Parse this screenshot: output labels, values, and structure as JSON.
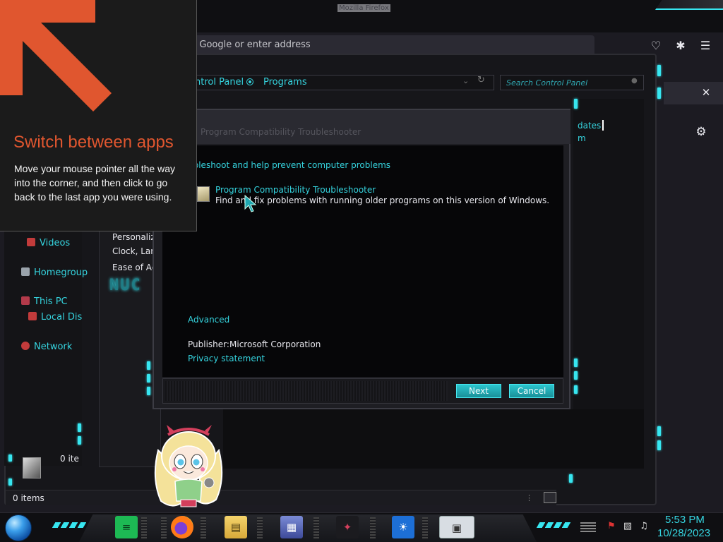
{
  "firefox": {
    "window_title": "Mozilla Firefox",
    "url_placeholder": "n Google or enter address"
  },
  "control_panel": {
    "breadcrumbs": [
      "ntrol Panel",
      "Programs"
    ],
    "search_placeholder": "Search Control Panel",
    "nav": {
      "videos": "Videos",
      "homegroup": "Homegroup",
      "this_pc": "This PC",
      "local_disk": "Local Dis",
      "network": "Network"
    },
    "middle_items": [
      "Personaliz",
      "Clock, Lar",
      "Ease of Ac"
    ],
    "logo_text": "NUC",
    "right_links": [
      "dates",
      "m"
    ],
    "status_items": "0 items",
    "status_items_partial": "0 ite"
  },
  "dialog": {
    "title": "Program Compatibility Troubleshooter",
    "heading": "ubleshoot and help prevent computer problems",
    "item_title": "Program Compatibility Troubleshooter",
    "item_description": "Find and fix problems with running older programs on this version of Windows.",
    "advanced_link": "Advanced",
    "publisher_label": "Publisher:",
    "publisher_value": "Microsoft Corporation",
    "privacy_link": "Privacy statement",
    "next_button": "Next",
    "cancel_button": "Cancel"
  },
  "tip": {
    "title": "Switch between apps",
    "body": "Move your mouse pointer all the way into the corner, and then click to go back to the last app you were using."
  },
  "taskbar": {
    "apps": [
      "spotify-notes-icon",
      "firefox-icon",
      "file-explorer-icon",
      "control-panel-icon",
      "game-icon",
      "weather-icon",
      "troubleshooter-icon"
    ],
    "clock_time": "5:53 PM",
    "clock_date": "10/28/2023"
  },
  "colors": {
    "accent": "#37e6f0",
    "link": "#35d4df",
    "tip_title": "#e0562f",
    "tip_arrow": "#e0562f"
  }
}
